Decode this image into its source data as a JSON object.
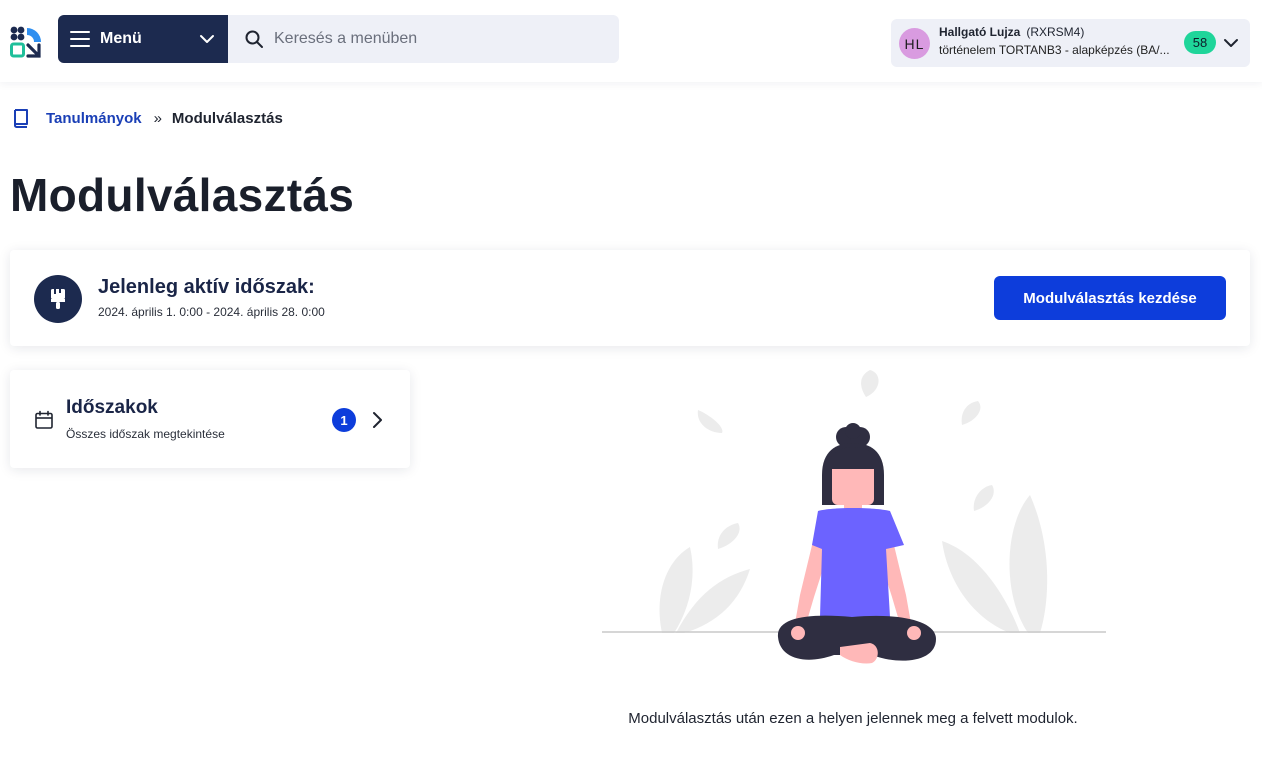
{
  "topbar": {
    "menu_label": "Menü",
    "search_placeholder": "Keresés a menüben",
    "user": {
      "initials": "HL",
      "name": "Hallgató Lujza",
      "code": "(RXRSM4)",
      "program": "történelem TORTANB3 - alapképzés (BA/...",
      "notification_count": "58"
    }
  },
  "breadcrumb": {
    "parent": "Tanulmányok",
    "separator": "»",
    "current": "Modulválasztás"
  },
  "page_title": "Modulválasztás",
  "active_period": {
    "title": "Jelenleg aktív időszak:",
    "dates": "2024. április 1. 0:00 - 2024. április 28. 0:00",
    "button_label": "Modulválasztás kezdése"
  },
  "periods_card": {
    "title": "Időszakok",
    "subtitle": "Összes időszak megtekintése",
    "count": "1"
  },
  "empty_state": {
    "message": "Modulválasztás után ezen a helyen jelennek meg a felvett modulok."
  },
  "colors": {
    "navy": "#1c2a4f",
    "primary_blue": "#0d3ddb",
    "badge_green": "#1fd59a",
    "avatar_pink": "#d99be0",
    "figure_purple": "#6c63ff"
  }
}
